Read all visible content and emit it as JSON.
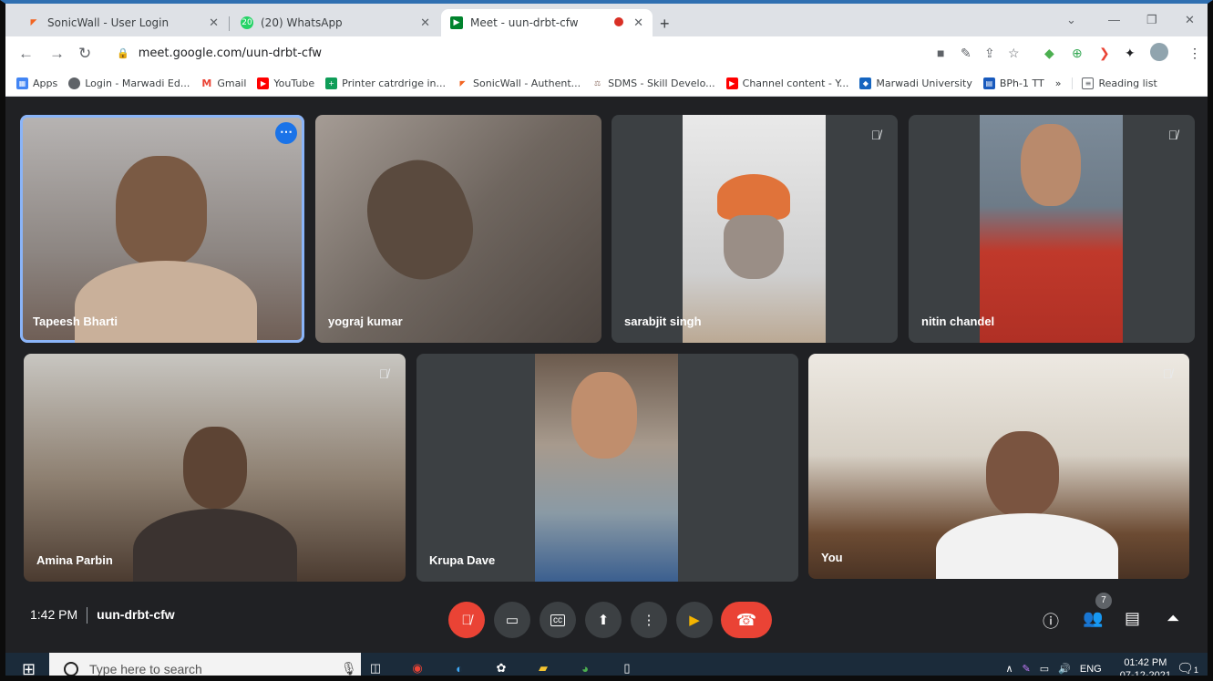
{
  "browser": {
    "tabs": [
      {
        "title": "SonicWall - User Login",
        "icon": "sonicwall-icon",
        "color": "#f26522"
      },
      {
        "title": "(20) WhatsApp",
        "icon": "whatsapp-icon",
        "color": "#25d366",
        "badge": "20"
      },
      {
        "title": "Meet - uun-drbt-cfw",
        "icon": "meet-icon",
        "color": "#00832d"
      }
    ],
    "url": "meet.google.com/uun-drbt-cfw",
    "bookmarks": [
      {
        "label": "Apps",
        "color": "#4285f4"
      },
      {
        "label": "Login - Marwadi Ed...",
        "color": "#5f6368"
      },
      {
        "label": "Gmail",
        "color": "#ea4335"
      },
      {
        "label": "YouTube",
        "color": "#ff0000"
      },
      {
        "label": "Printer catrdrige in...",
        "color": "#0f9d58"
      },
      {
        "label": "SonicWall - Authent...",
        "color": "#f26522"
      },
      {
        "label": "SDMS - Skill Develo...",
        "color": "#8d6e63"
      },
      {
        "label": "Channel content - Y...",
        "color": "#ff0000"
      },
      {
        "label": "Marwadi University",
        "color": "#1565c0"
      },
      {
        "label": "BPh-1 TT",
        "color": "#185abd"
      }
    ],
    "reading_list": "Reading list",
    "overflow": "»"
  },
  "meet": {
    "participants": [
      {
        "name": "Tapeesh Bharti",
        "muted": false,
        "speaking": true
      },
      {
        "name": "yograj kumar",
        "muted": false,
        "speaking": false
      },
      {
        "name": "sarabjit singh",
        "muted": true,
        "speaking": false
      },
      {
        "name": "nitin chandel",
        "muted": true,
        "speaking": false
      },
      {
        "name": "Amina Parbin",
        "muted": true,
        "speaking": false
      },
      {
        "name": "Krupa Dave",
        "muted": false,
        "speaking": false
      },
      {
        "name": "You",
        "muted": true,
        "speaking": false
      }
    ],
    "time": "1:42 PM",
    "meeting_code": "uun-drbt-cfw",
    "participant_count": "7"
  },
  "taskbar": {
    "search_placeholder": "Type here to search",
    "language": "ENG",
    "time": "01:42 PM",
    "date": "07-12-2021",
    "notification_count": "1"
  }
}
